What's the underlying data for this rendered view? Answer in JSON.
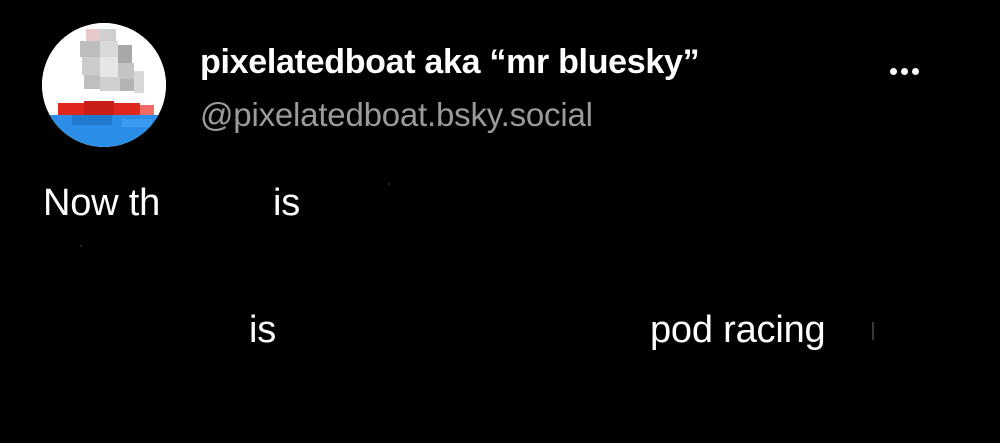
{
  "post": {
    "author": {
      "display_name": "pixelatedboat aka “mr bluesky”",
      "handle": "@pixelatedboat.bsky.social",
      "avatar_icon": "pixel-boat-avatar-icon"
    },
    "more_icon": "ellipsis-icon",
    "text_fragments": [
      "Now th",
      "is",
      "is",
      "pod racing"
    ]
  },
  "colors": {
    "background": "#000000",
    "text": "#ffffff",
    "handle": "#9a9a9a",
    "avatar_red": "#e0261d",
    "avatar_blue": "#2a8ee8"
  }
}
